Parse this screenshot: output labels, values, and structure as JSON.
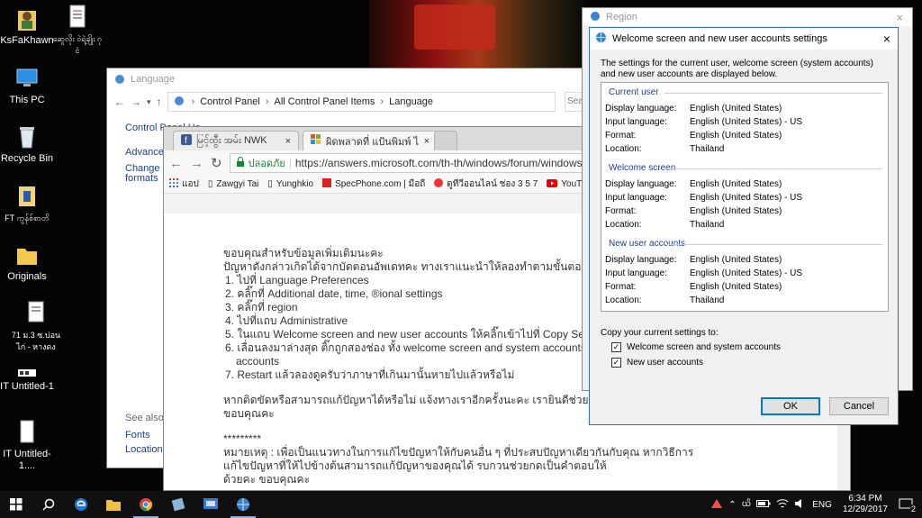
{
  "desktop": {
    "icons": [
      {
        "label": "KsFaKhawn",
        "icon": "user-folder-icon"
      },
      {
        "label": "ဆွေလိုး ဝဲရဲ့ချိုး ဂု ငံ",
        "icon": "document-icon"
      },
      {
        "label": "This PC",
        "icon": "computer-icon"
      },
      {
        "label": "Recycle Bin",
        "icon": "recycle-bin-icon"
      },
      {
        "label": "FT ကွန်စ်စာတိ",
        "icon": "folder-icon"
      },
      {
        "label": "Originals",
        "icon": "folder-icon"
      },
      {
        "label": "71 ม.3 ซ.บ่อน ไก่ - หางดง",
        "icon": "document-icon"
      },
      {
        "label": "IT Untitled-1",
        "icon": "image-icon"
      },
      {
        "label": "IT Untitled-1....",
        "icon": "image-icon"
      }
    ]
  },
  "language_window": {
    "title": "Language",
    "breadcrumb": [
      "Control Panel",
      "All Control Panel Items",
      "Language"
    ],
    "search_placeholder": "Sear",
    "sidebar": {
      "home": "Control Panel Ho",
      "advanced": "Advanced",
      "change": "Change da",
      "formats": "formats",
      "see_also": "See also",
      "fonts": "Fonts",
      "location": "Location"
    }
  },
  "browser": {
    "tabs": [
      {
        "title": "မြင့်ထွီး အမ်း NWK"
      },
      {
        "title": "ผิดพลาดที่ แป้นพิมพ์ ไอคัคภาษ"
      }
    ],
    "secure_label": "ปลอดภัย",
    "url": "https://answers.microsoft.com/th-th/windows/forum/windows_10-hardw",
    "bookmarks": [
      "แอป",
      "Zawgyi Tai",
      "Yunghkio",
      "SpecPhone.com | มือถื",
      "ดูทีวีออนไลน์ ช่อง 3 5 7",
      "YouTube"
    ],
    "article": {
      "intro1": "ขอบคุณสำหรับข้อมูลเพิ่มเติมนะคะ",
      "intro2": "ปัญหาดังกล่าวเกิดได้จากบัดตอนอัพเดทคะ ทางเราแนะนำให้ลองทำตามขั้นตอนนี้คะ",
      "steps": [
        "1. ไปที่ Language Preferences",
        "2. คลิ๊กที่ Additional date, time, ®ional settings",
        "3. คลิ๊กที่ region",
        "4. ไปที่แถบ Administrative",
        "5. ในแถบ Welcome screen and new user accounts ให้คลิ๊กเข้าไปที่ Copy Settings",
        "6. เลื่อนลงมาล่างสุด ติ๊กถูกสองช่อง ทั้ง welcome screen and system accounts และ New",
        "accounts",
        "7. Restart แล้วลองดูครับว่าภาษาที่เกินมานั้นหายไปแล้วหรือไม่"
      ],
      "outro1": "หากติดขัดหรือสามารถแก้ปัญหาได้หรือไม่ แจ้งทางเราอีกครั้งนะคะ เรายินดีช่วยเหลือคุณเต็มที่คะ",
      "outro2": "ขอบคุณคะ",
      "stars": "*********",
      "note1": "หมายเหตุ : เพื่อเป็นแนวทางในการแก้ไขปัญหาให้กับคนอื่น ๆ ที่ประสบปัญหาเดียวกันกับคุณ หากวิธีการ",
      "note2": "แก้ไขปัญหาที่ให้ไปข้างต้นสามารถแก้ปัญหาของคุณได้ รบกวนช่วยกดเป็นคำตอบให้",
      "note3": "ด้วยคะ ขอบคุณคะ"
    }
  },
  "region": {
    "title": "Region"
  },
  "dialog": {
    "title": "Welcome screen and new user accounts settings",
    "description": "The settings for the current user, welcome screen (system accounts) and new user accounts are displayed below.",
    "sections": [
      {
        "heading": "Current user",
        "rows": [
          [
            "Display language:",
            "English (United States)"
          ],
          [
            "Input language:",
            "English (United States) - US"
          ],
          [
            "Format:",
            "English (United States)"
          ],
          [
            "Location:",
            "Thailand"
          ]
        ]
      },
      {
        "heading": "Welcome screen",
        "rows": [
          [
            "Display language:",
            "English (United States)"
          ],
          [
            "Input language:",
            "English (United States) - US"
          ],
          [
            "Format:",
            "English (United States)"
          ],
          [
            "Location:",
            "Thailand"
          ]
        ]
      },
      {
        "heading": "New user accounts",
        "rows": [
          [
            "Display language:",
            "English (United States)"
          ],
          [
            "Input language:",
            "English (United States) - US"
          ],
          [
            "Format:",
            "English (United States)"
          ],
          [
            "Location:",
            "Thailand"
          ]
        ]
      }
    ],
    "copy_label": "Copy your current settings to:",
    "cb1": "Welcome screen and system accounts",
    "cb2": "New user accounts",
    "ok": "OK",
    "cancel": "Cancel"
  },
  "taskbar": {
    "lang": "ENG",
    "time": "6:34 PM",
    "date": "12/29/2017",
    "notif": "2",
    "keyboard": "ᨿᩦ"
  }
}
